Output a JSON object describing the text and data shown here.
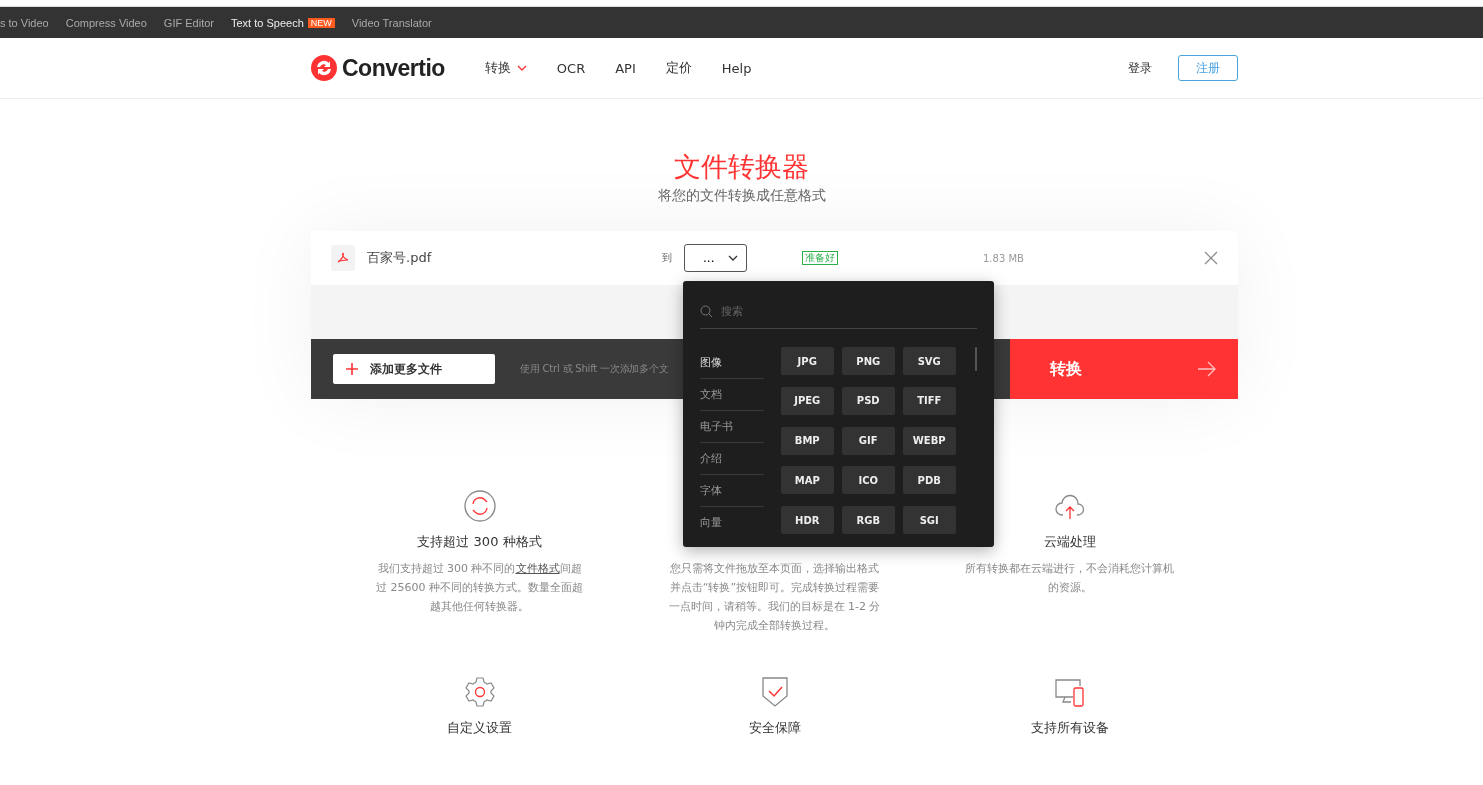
{
  "top_bar": {
    "links": [
      {
        "label": "s to Video"
      },
      {
        "label": "Compress Video"
      },
      {
        "label": "GIF Editor"
      },
      {
        "label": "Text to Speech",
        "badge": "NEW"
      },
      {
        "label": "Video Translator"
      }
    ]
  },
  "header": {
    "logo": "Convertio",
    "nav": [
      {
        "label": "转换",
        "dropdown": true
      },
      {
        "label": "OCR",
        "dropdown": false
      },
      {
        "label": "API",
        "dropdown": false
      },
      {
        "label": "定价",
        "dropdown": false
      },
      {
        "label": "Help",
        "dropdown": false
      }
    ],
    "login": "登录",
    "signup": "注册"
  },
  "hero": {
    "title": "文件转换器",
    "subtitle": "将您的文件转换成任意格式"
  },
  "file": {
    "name": "百家号.pdf",
    "to_label": "到",
    "format": "...",
    "status": "准备好",
    "size": "1.83 MB"
  },
  "actions": {
    "add_button": "添加更多文件",
    "hint": "使用 Ctrl 或 Shift 一次添加多个文",
    "convert_button": "转换"
  },
  "format_menu": {
    "search_placeholder": "搜索",
    "categories": [
      {
        "label": "图像",
        "selected": true
      },
      {
        "label": "文档",
        "selected": false
      },
      {
        "label": "电子书",
        "selected": false
      },
      {
        "label": "介绍",
        "selected": false
      },
      {
        "label": "字体",
        "selected": false
      },
      {
        "label": "向量",
        "selected": false
      }
    ],
    "formats": [
      "JPG",
      "PNG",
      "SVG",
      "JPEG",
      "PSD",
      "TIFF",
      "BMP",
      "GIF",
      "WEBP",
      "MAP",
      "ICO",
      "PDB",
      "HDR",
      "RGB",
      "SGI"
    ]
  },
  "features": [
    {
      "kind": "formats",
      "title": "支持超过 300 种格式",
      "text": "我们支持超过 300 种不同的",
      "link": "文件格式",
      "text_after": "间超过 25600 种不同的转换方式。数量全面超越其他任何转换器。"
    },
    {
      "kind": "covered",
      "text": "您只需将文件拖放至本页面，选择输出格式并点击“转换”按钮即可。完成转换过程需要一点时间，请稍等。我们的目标是在 1-2 分钟内完成全部转换过程。"
    },
    {
      "kind": "cloud",
      "title": "云端处理",
      "text": "所有转换都在云端进行，不会消耗您计算机的资源。"
    },
    {
      "kind": "gear",
      "title": "自定义设置"
    },
    {
      "kind": "shield",
      "title": "安全保障"
    },
    {
      "kind": "devices",
      "title": "支持所有设备"
    }
  ]
}
